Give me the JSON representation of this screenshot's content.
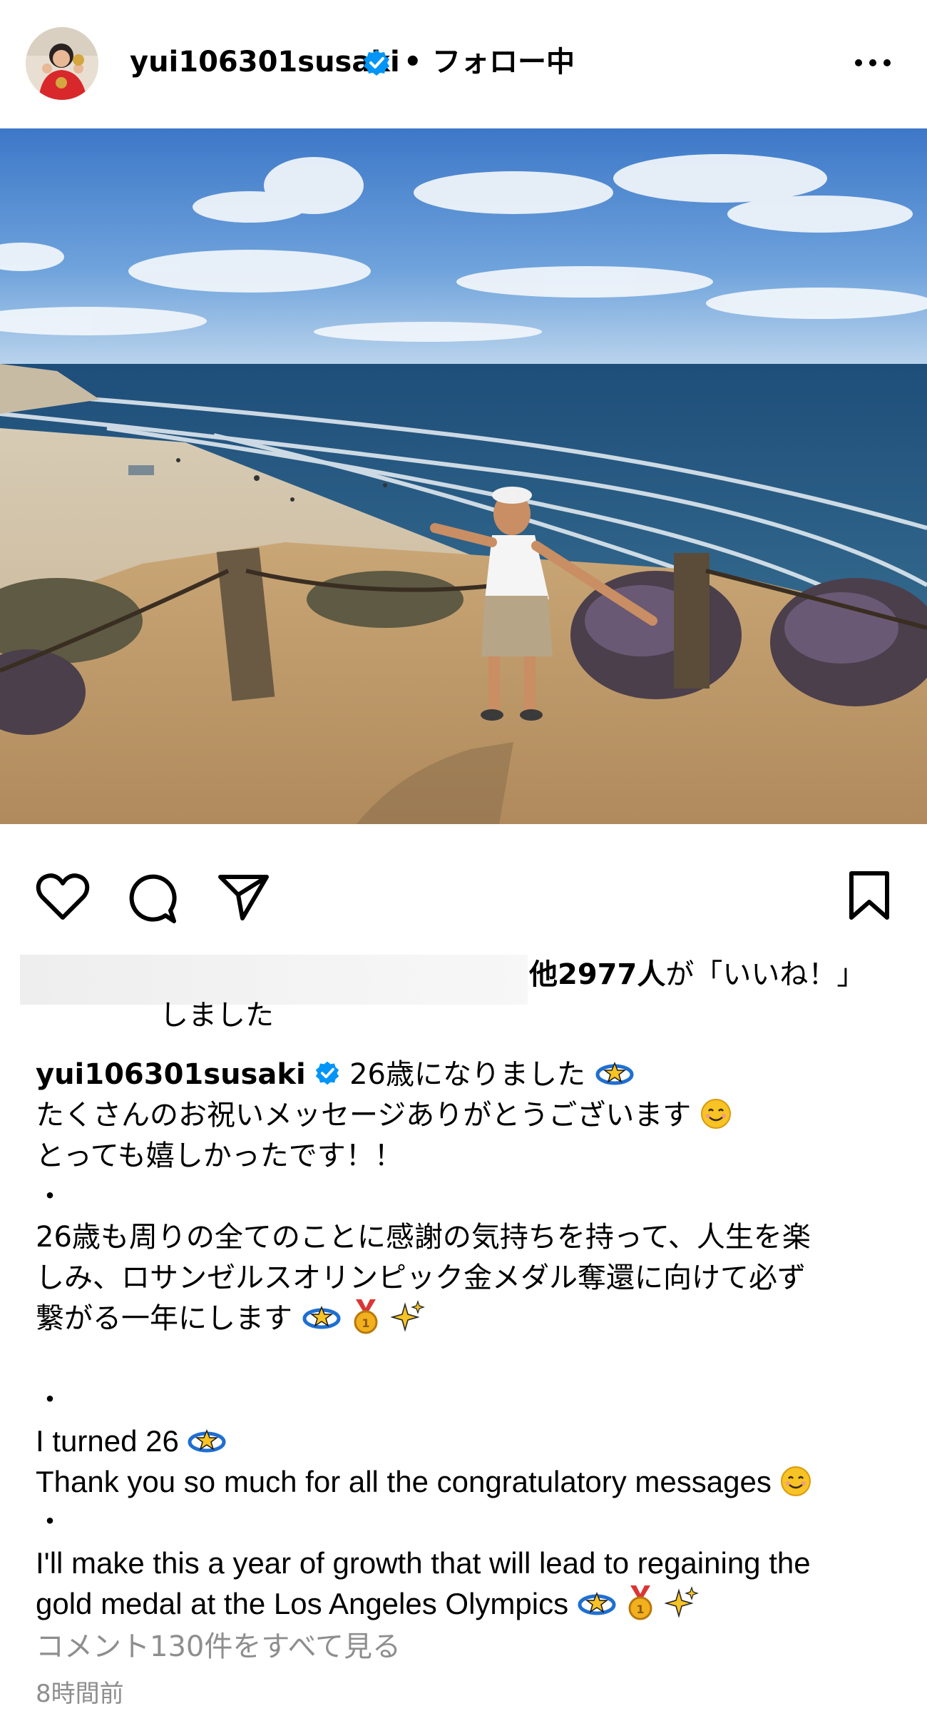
{
  "post": {
    "username": "yui106301susaki",
    "separator": "•",
    "follow_state": "フォロー中"
  },
  "likes": {
    "count_text": "他2977人",
    "suffix": "が「いいね！」",
    "cont": "しました"
  },
  "caption": {
    "username": "yui106301susaki",
    "lines": [
      "26歳になりました",
      "たくさんのお祝いメッセージありがとうございます",
      "とっても嬉しかったです！！",
      "・",
      "26歳も周りの全てのことに感謝の気持ちを持って、人生を楽",
      "しみ、ロサンゼルスオリンピック金メダル奪還に向けて必ず",
      "繋がる一年にします",
      "",
      "・",
      "I turned 26",
      "Thank you so much for all the congratulatory messages",
      "・",
      "I'll make this a year of growth that will lead to regaining the",
      "gold medal at the Los Angeles Olympics"
    ]
  },
  "comments_link": "コメント130件をすべて見る",
  "timestamp": "8時間前",
  "icons": {
    "verified": "verified-badge-icon",
    "more": "more-options-icon",
    "like": "heart-icon",
    "comment": "comment-icon",
    "share": "send-icon",
    "save": "bookmark-icon"
  },
  "colors": {
    "verified": "#0095f6",
    "muted": "#8e8e8e",
    "text": "#000000"
  }
}
